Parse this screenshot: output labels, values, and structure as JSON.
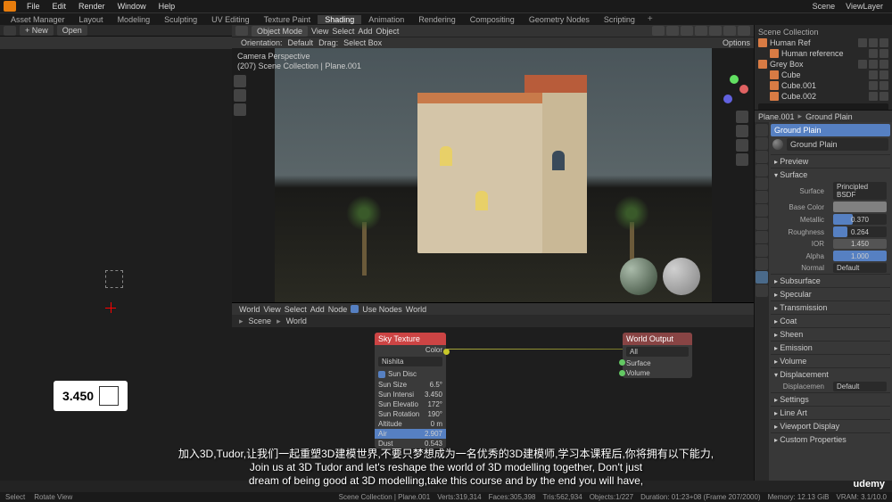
{
  "menubar": {
    "items": [
      "File",
      "Edit",
      "Render",
      "Window",
      "Help"
    ],
    "scene_label": "Scene",
    "viewlayer_label": "ViewLayer"
  },
  "workspaces": {
    "tabs": [
      "Asset Manager",
      "Layout",
      "Modeling",
      "Sculpting",
      "UV Editing",
      "Texture Paint",
      "Shading",
      "Animation",
      "Rendering",
      "Compositing",
      "Geometry Nodes",
      "Scripting"
    ],
    "active": "Shading"
  },
  "header": {
    "new": "+ New",
    "open": "Open",
    "object_mode": "Object Mode",
    "view": "View",
    "select": "Select",
    "add": "Add",
    "object": "Object"
  },
  "viewport_header2": {
    "orientation": "Orientation:",
    "orientation_val": "Default",
    "drag": "Drag:",
    "select_box": "Select Box",
    "options": "Options"
  },
  "viewport_info": {
    "line1": "Camera Perspective",
    "line2": "(207) Scene Collection | Plane.001"
  },
  "node_editor": {
    "header": {
      "world_label": "World",
      "view": "View",
      "select": "Select",
      "add": "Add",
      "node": "Node",
      "use_nodes": "Use Nodes",
      "world_name": "World"
    },
    "breadcrumb": {
      "scene": "Scene",
      "world": "World"
    },
    "sky_node": {
      "title": "Sky Texture",
      "color_out": "Color",
      "type": "Nishita",
      "sun_disc": "Sun Disc",
      "rows": [
        {
          "label": "Sun Size",
          "val": "6.5°"
        },
        {
          "label": "Sun Intensi",
          "val": "3.450"
        },
        {
          "label": "Sun Elevatio",
          "val": "172°"
        },
        {
          "label": "Sun Rotation",
          "val": "190°"
        },
        {
          "label": "Altitude",
          "val": "0 m"
        },
        {
          "label": "Air",
          "val": "2.907"
        },
        {
          "label": "Dust",
          "val": "0.543"
        }
      ]
    },
    "output_node": {
      "title": "World Output",
      "target": "All",
      "surface": "Surface",
      "volume": "Volume"
    }
  },
  "outliner": {
    "header": "Scene Collection",
    "items": [
      {
        "name": "Human Ref",
        "indent": 0
      },
      {
        "name": "Human reference",
        "indent": 1
      },
      {
        "name": "Grey Box",
        "indent": 0
      },
      {
        "name": "Cube",
        "indent": 1
      },
      {
        "name": "Cube.001",
        "indent": 1
      },
      {
        "name": "Cube.002",
        "indent": 1
      }
    ]
  },
  "props": {
    "breadcrumb_obj": "Plane.001",
    "breadcrumb_mat": "Ground Plain",
    "material_name": "Ground Plain",
    "preview": "Preview",
    "surface_section": "Surface",
    "surface_label": "Surface",
    "surface_val": "Principled BSDF",
    "base_color": "Base Color",
    "metallic": "Metallic",
    "metallic_val": "0.370",
    "roughness": "Roughness",
    "roughness_val": "0.264",
    "ior": "IOR",
    "ior_val": "1.450",
    "alpha": "Alpha",
    "alpha_val": "1.000",
    "normal": "Normal",
    "normal_val": "Default",
    "sections": [
      "Subsurface",
      "Specular",
      "Transmission",
      "Coat",
      "Sheen",
      "Emission"
    ],
    "volume": "Volume",
    "displacement": "Displacement",
    "displace_label": "Displacemen",
    "displace_val": "Default",
    "settings": "Settings",
    "line_art": "Line Art",
    "viewport_display": "Viewport Display",
    "custom_props": "Custom Properties"
  },
  "tooltip": "3.450",
  "subtitle": {
    "cn": "加入3D,Tudor,让我们一起重塑3D建模世界,不要只梦想成为一名优秀的3D建模师,学习本课程后,你将拥有以下能力,",
    "en1": "Join us at 3D Tudor and let's reshape the world of 3D modelling together, Don't just",
    "en2": "dream of being good at 3D modelling,take this course and by the end you will have,"
  },
  "statusbar": {
    "select": "Select",
    "rotate": "Rotate View",
    "context": "Scene Collection | Plane.001",
    "verts": "Verts:319,314",
    "faces": "Faces:305,398",
    "tris": "Tris:562,934",
    "objects": "Objects:1/227",
    "duration": "Duration: 01:23+08 (Frame 207/2000)",
    "memory": "Memory: 12.13 GiB",
    "vram": "VRAM: 3.1/10.0"
  },
  "udemy": "udemy"
}
